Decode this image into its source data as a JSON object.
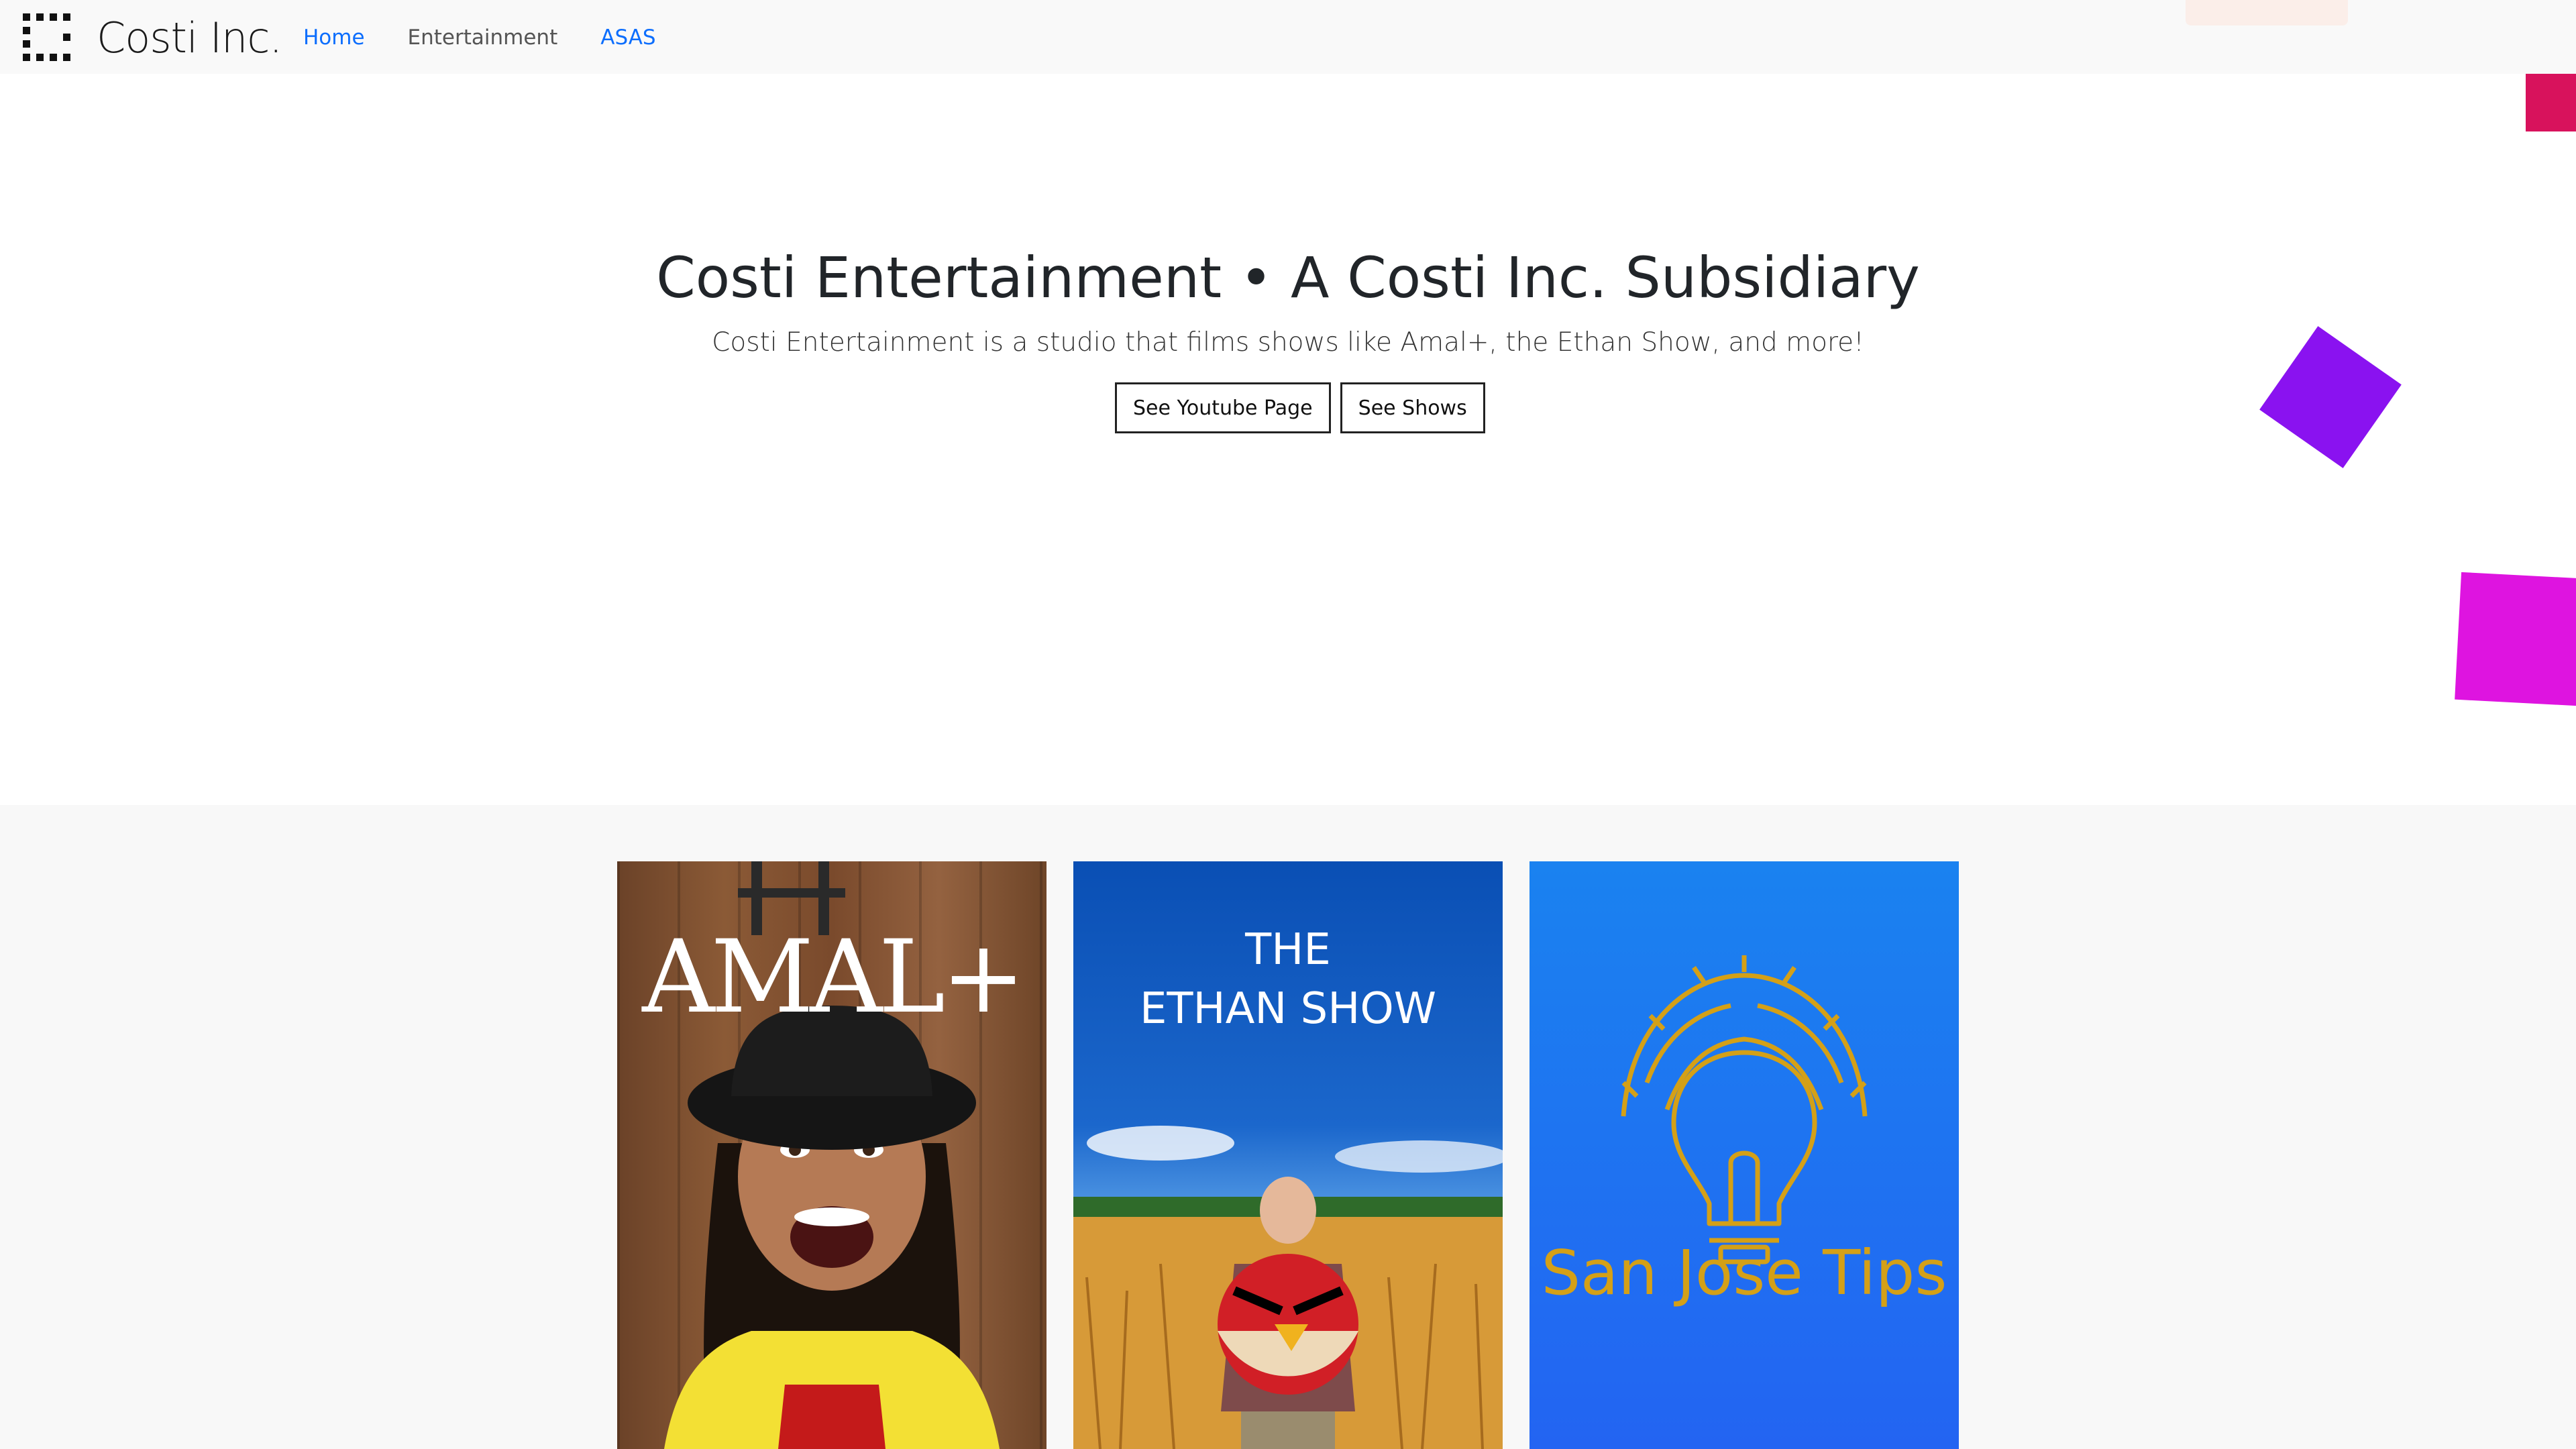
{
  "navbar": {
    "brand": "Costi Inc.",
    "links": [
      {
        "label": "Home",
        "active": true
      },
      {
        "label": "Entertainment",
        "active": false
      },
      {
        "label": "ASAS",
        "active": false
      }
    ]
  },
  "hero": {
    "title": "Costi Entertainment • A Costi Inc. Subsidiary",
    "subtitle": "Costi Entertainment is a studio that films shows like Amal+, the Ethan Show, and more!",
    "buttons": [
      "See Youtube Page",
      "See Shows"
    ]
  },
  "shows": {
    "cards": [
      {
        "title": "AMAL+",
        "title_color": "#ffffff"
      },
      {
        "title_line1": "THE",
        "title_line2": "ETHAN SHOW",
        "title_color": "#ffffff"
      },
      {
        "title": "San Jose Tips",
        "title_color": "#d4a017",
        "icon": "lightbulb-sun-icon"
      }
    ]
  },
  "colors": {
    "link_blue": "#0d6efd",
    "deco_square_1": "#d8125c",
    "deco_square_2": "#8a12f0",
    "deco_square_3": "#de14e0"
  }
}
